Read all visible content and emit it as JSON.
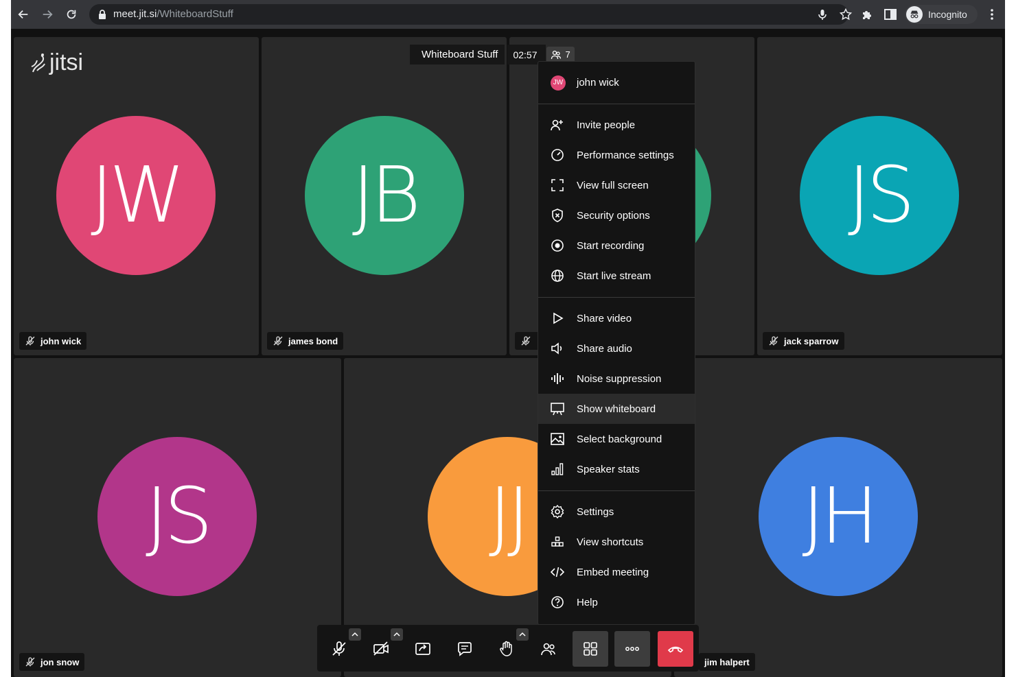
{
  "browser": {
    "url_host": "meet.jit.si",
    "url_path": "/WhiteboardStuff",
    "profile_label": "Incognito"
  },
  "app": {
    "logo_text": "jitsi",
    "meeting_title": "Whiteboard Stuff",
    "timer": "02:57",
    "participant_count": "7"
  },
  "participants": [
    {
      "initials": "JW",
      "name": "john wick",
      "color": "#e04775"
    },
    {
      "initials": "JB",
      "name": "james bond",
      "color": "#2ea276"
    },
    {
      "initials": "",
      "name": "",
      "color": "#2ea276"
    },
    {
      "initials": "JS",
      "name": "jack sparrow",
      "color": "#0aa5b4"
    },
    {
      "initials": "JS",
      "name": "jon snow",
      "color": "#b2368a"
    },
    {
      "initials": "JJ",
      "name": "",
      "color": "#f99b3d"
    },
    {
      "initials": "JH",
      "name": "jim halpert",
      "color": "#3f7fe0"
    }
  ],
  "menu": {
    "header": {
      "initials": "JW",
      "name": "john wick"
    },
    "group1": [
      {
        "label": "Invite people",
        "icon": "invite-icon"
      },
      {
        "label": "Performance settings",
        "icon": "gauge-icon"
      },
      {
        "label": "View full screen",
        "icon": "fullscreen-icon"
      },
      {
        "label": "Security options",
        "icon": "shield-icon"
      },
      {
        "label": "Start recording",
        "icon": "record-icon"
      },
      {
        "label": "Start live stream",
        "icon": "globe-icon"
      }
    ],
    "group2": [
      {
        "label": "Share video",
        "icon": "play-icon"
      },
      {
        "label": "Share audio",
        "icon": "speaker-icon"
      },
      {
        "label": "Noise suppression",
        "icon": "waveform-icon"
      },
      {
        "label": "Show whiteboard",
        "icon": "whiteboard-icon"
      },
      {
        "label": "Select background",
        "icon": "image-icon"
      },
      {
        "label": "Speaker stats",
        "icon": "bar-chart-icon"
      }
    ],
    "group3": [
      {
        "label": "Settings",
        "icon": "gear-icon"
      },
      {
        "label": "View shortcuts",
        "icon": "shortcuts-icon"
      },
      {
        "label": "Embed meeting",
        "icon": "code-icon"
      },
      {
        "label": "Help",
        "icon": "help-icon"
      }
    ]
  },
  "toolbar": {
    "buttons": [
      "microphone",
      "camera",
      "share-screen",
      "chat",
      "raise-hand",
      "participants",
      "tile-view",
      "more",
      "leave"
    ]
  }
}
